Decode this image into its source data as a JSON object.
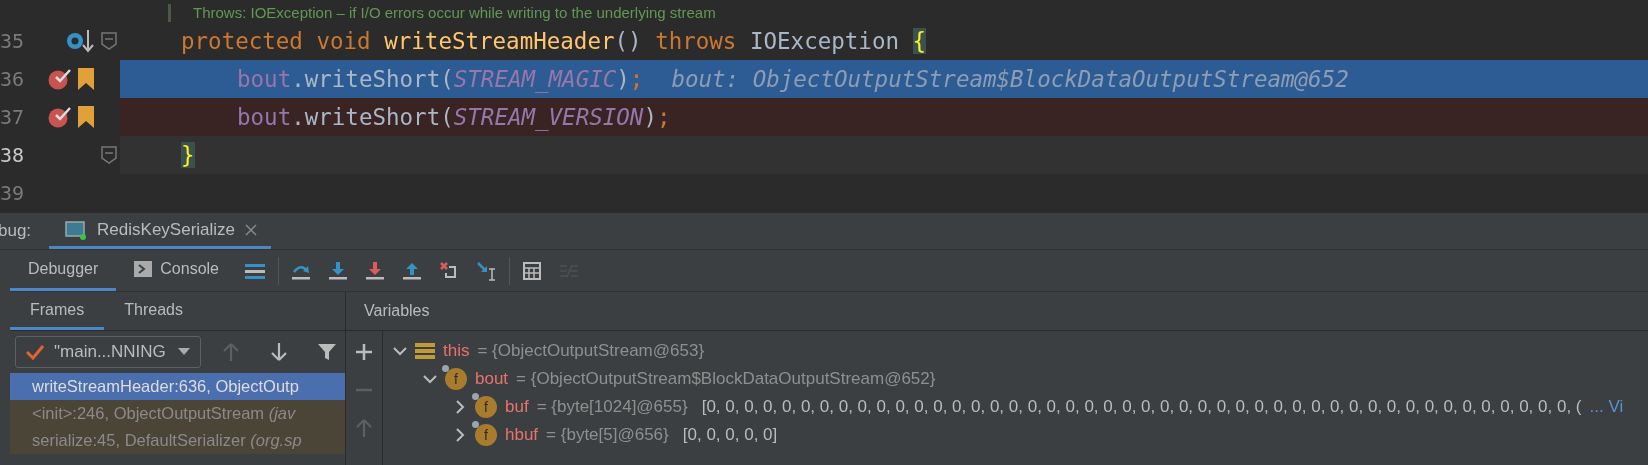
{
  "editor": {
    "doc_line": "Throws: IOException – if I/O errors occur while writing to the underlying stream",
    "lines": [
      {
        "number": "35",
        "kind": "declaration",
        "method_marker": true,
        "breakpoint": false,
        "bookmark": false,
        "execution_point": false,
        "caret": false,
        "fold": true,
        "tokens": [
          {
            "kind": "keyword",
            "text": "protected void "
          },
          {
            "kind": "method",
            "text": "writeStreamHeader"
          },
          {
            "kind": "plain",
            "text": "() "
          },
          {
            "kind": "keyword",
            "text": "throws "
          },
          {
            "kind": "plain",
            "text": "IOException "
          },
          {
            "kind": "brace",
            "text": "{"
          }
        ]
      },
      {
        "number": "36",
        "kind": "statement",
        "method_marker": false,
        "breakpoint": true,
        "bookmark": true,
        "execution_point": true,
        "caret": false,
        "fold": false,
        "tokens": [
          {
            "kind": "field",
            "text": "bout"
          },
          {
            "kind": "plain",
            "text": ".writeShort("
          },
          {
            "kind": "constant",
            "text": "STREAM_MAGIC"
          },
          {
            "kind": "plain",
            "text": ")"
          },
          {
            "kind": "punct",
            "text": ";"
          },
          {
            "kind": "hint",
            "text": "bout: ObjectOutputStream$BlockDataOutputStream@652"
          }
        ]
      },
      {
        "number": "37",
        "kind": "statement",
        "method_marker": false,
        "breakpoint": true,
        "bookmark": true,
        "execution_point": false,
        "caret": false,
        "fold": false,
        "tokens": [
          {
            "kind": "field",
            "text": "bout"
          },
          {
            "kind": "plain",
            "text": ".writeShort("
          },
          {
            "kind": "constant",
            "text": "STREAM_VERSION"
          },
          {
            "kind": "plain",
            "text": ")"
          },
          {
            "kind": "punct",
            "text": ";"
          }
        ]
      },
      {
        "number": "38",
        "kind": "close",
        "method_marker": false,
        "breakpoint": false,
        "bookmark": false,
        "execution_point": false,
        "caret": true,
        "fold": true,
        "tokens": [
          {
            "kind": "brace",
            "text": "}"
          }
        ]
      },
      {
        "number": "39"
      }
    ]
  },
  "debug": {
    "label": "bug:",
    "session_tab": {
      "label": "RedisKeySerialize",
      "selected": true
    },
    "tabs": [
      {
        "label": "Debugger",
        "selected": true,
        "kind": "plain"
      },
      {
        "label": "Console",
        "selected": false,
        "kind": "console"
      }
    ],
    "toolbar": [
      {
        "kind": "layout",
        "disabled": false
      },
      {
        "kind": "step-over",
        "disabled": false
      },
      {
        "kind": "step-into",
        "disabled": false
      },
      {
        "kind": "force-step-into",
        "disabled": false
      },
      {
        "kind": "step-out",
        "disabled": false
      },
      {
        "kind": "drop-frame",
        "disabled": false
      },
      {
        "kind": "run-to-cursor",
        "disabled": false
      },
      {
        "kind": "evaluate",
        "disabled": false
      },
      {
        "kind": "trace",
        "disabled": true
      }
    ],
    "frames_panel": {
      "tabs": [
        {
          "label": "Frames",
          "selected": true
        },
        {
          "label": "Threads",
          "selected": false
        }
      ],
      "thread_select": "\"main...NNING",
      "nav": [
        {
          "kind": "up",
          "disabled": true
        },
        {
          "kind": "down",
          "disabled": false
        },
        {
          "kind": "filter",
          "disabled": false
        }
      ],
      "frames": [
        {
          "text": "writeStreamHeader:636, ObjectOutp",
          "selected": true,
          "kind": "app"
        },
        {
          "text": "<init>:246, ObjectOutputStream *(jav*",
          "selected": false,
          "kind": "library"
        },
        {
          "text": "serialize:45, DefaultSerializer *(org.sp*",
          "selected": false,
          "kind": "library"
        }
      ]
    },
    "variables_panel": {
      "title": "Variables",
      "side_buttons": [
        {
          "kind": "add",
          "disabled": false
        },
        {
          "kind": "remove",
          "disabled": true
        },
        {
          "kind": "up",
          "disabled": true
        }
      ],
      "tree": [
        {
          "name": "this",
          "value": "= {ObjectOutputStream@653}",
          "kind": "object",
          "expanded": true,
          "children": [
            {
              "name": "bout",
              "value": "= {ObjectOutputStream$BlockDataOutputStream@652}",
              "kind": "field",
              "badge": "f",
              "expanded": true,
              "children": [
                {
                  "name": "buf",
                  "value": "= {byte[1024]@655}",
                  "extra": "[0, 0, 0, 0, 0, 0, 0, 0, 0, 0, 0, 0, 0, 0, 0, 0, 0, 0, 0, 0, 0, 0, 0, 0, 0, 0, 0, 0, 0, 0, 0, 0, 0, 0, 0, 0, 0, 0, 0, 0, 0, 0, 0, 0, 0, 0, (",
                  "link": "... Vi",
                  "kind": "field",
                  "badge": "f",
                  "expanded": false
                },
                {
                  "name": "hbuf",
                  "value": "= {byte[5]@656}",
                  "extra": "[0, 0, 0, 0, 0]",
                  "kind": "field",
                  "badge": "f",
                  "expanded": false
                }
              ]
            }
          ]
        }
      ]
    }
  }
}
